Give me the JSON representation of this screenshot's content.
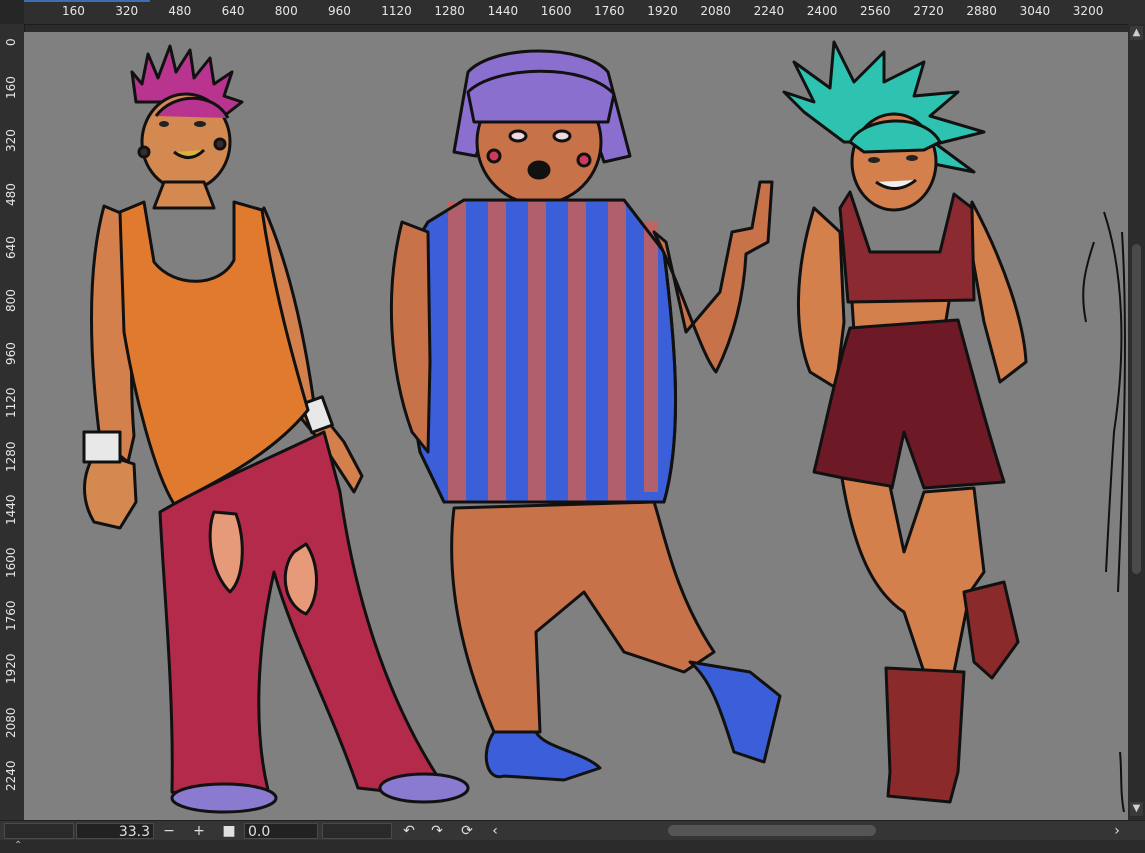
{
  "ruler": {
    "top_labels": [
      "160",
      "320",
      "480",
      "640",
      "800",
      "960",
      "1120",
      "1280",
      "1440",
      "1600",
      "1760",
      "1920",
      "2080",
      "2240",
      "2400",
      "2560",
      "2720",
      "2880",
      "3040",
      "3200"
    ],
    "left_labels": [
      "0",
      "160",
      "320",
      "480",
      "640",
      "800",
      "960",
      "1120",
      "1280",
      "1440",
      "1600",
      "1760",
      "1920",
      "2080",
      "2240"
    ]
  },
  "statusbar": {
    "zoom_value": "33.3",
    "zoom_out_label": "−",
    "zoom_in_label": "+",
    "fit_icon": "square-icon",
    "rotation_value": "0.0",
    "rotate_left_icon": "rotate-left-icon",
    "rotate_right_icon": "rotate-right-icon",
    "reset_rotation_icon": "reset-rotation-icon",
    "scroll_left_icon": "chevron-left-icon",
    "scroll_right_icon": "chevron-right-icon"
  },
  "vscroll": {
    "up_icon": "chevron-up-icon",
    "down_icon": "chevron-down-icon"
  },
  "colors": {
    "canvas_bg": "#808080",
    "chrome_bg": "#2f2f2f",
    "accent": "#3b6fb1"
  }
}
